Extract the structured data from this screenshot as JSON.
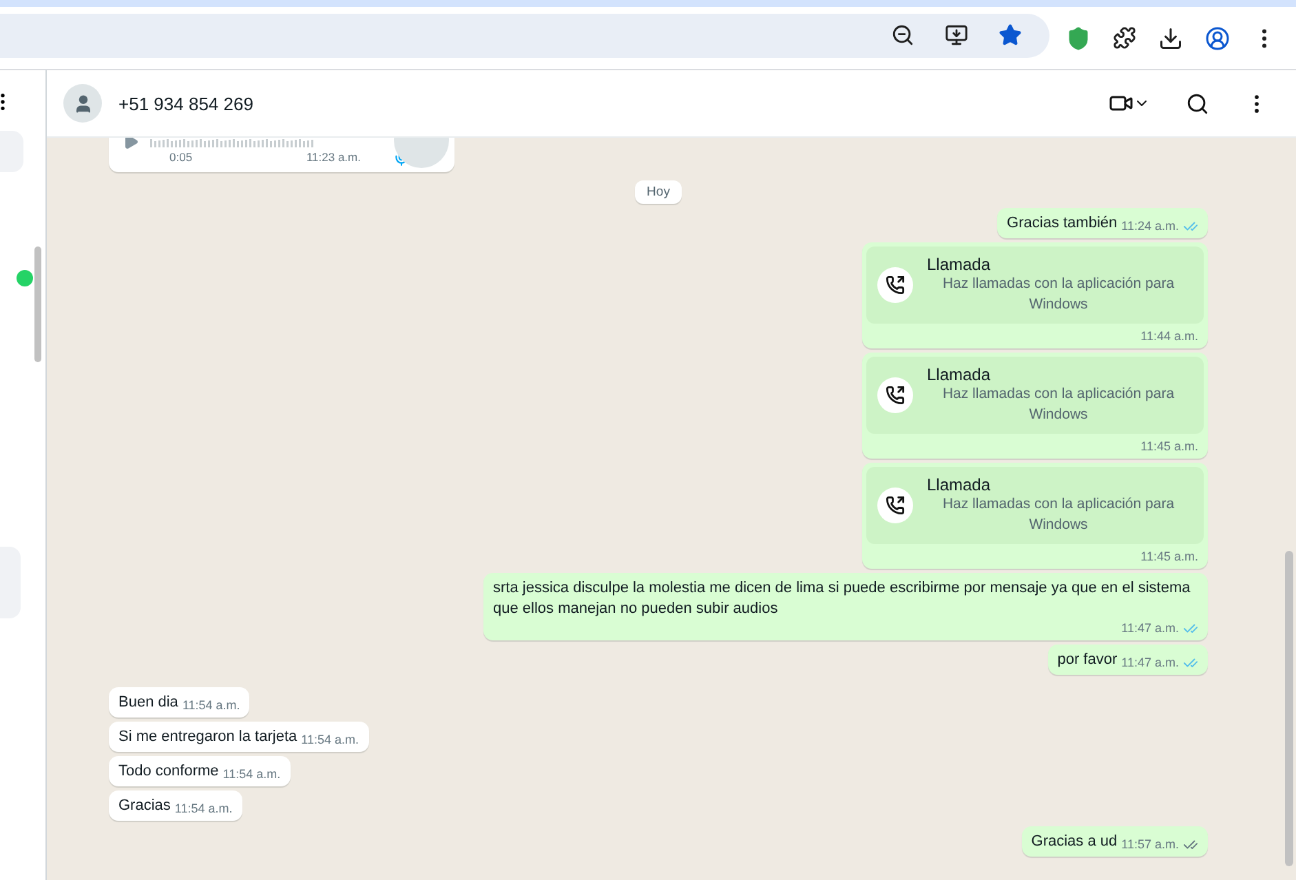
{
  "contact": {
    "name": "+51 934 854 269"
  },
  "messages": [
    {
      "kind": "audio",
      "outgoing": false,
      "duration": "0:05",
      "time": "11:23 a.m."
    },
    {
      "kind": "date",
      "label": "Hoy"
    },
    {
      "kind": "text",
      "outgoing": true,
      "text": "Gracias también",
      "time": "11:24 a.m.",
      "read": true
    },
    {
      "kind": "call",
      "outgoing": true,
      "title": "Llamada",
      "note": "Haz llamadas con la aplicación para Windows",
      "time": "11:44 a.m."
    },
    {
      "kind": "call",
      "outgoing": true,
      "title": "Llamada",
      "note": "Haz llamadas con la aplicación para Windows",
      "time": "11:45 a.m."
    },
    {
      "kind": "call",
      "outgoing": true,
      "title": "Llamada",
      "note": "Haz llamadas con la aplicación para Windows",
      "time": "11:45 a.m."
    },
    {
      "kind": "text",
      "outgoing": true,
      "text": "srta jessica disculpe la molestia me dicen de lima si puede escribirme por mensaje ya que en el sistema que ellos manejan no pueden subir audios",
      "time": "11:47 a.m.",
      "read": true
    },
    {
      "kind": "text",
      "outgoing": true,
      "text": "por favor",
      "time": "11:47 a.m.",
      "read": true
    },
    {
      "kind": "text",
      "outgoing": false,
      "text": "Buen dia",
      "time": "11:54 a.m."
    },
    {
      "kind": "text",
      "outgoing": false,
      "text": "Si me entregaron la tarjeta",
      "time": "11:54 a.m."
    },
    {
      "kind": "text",
      "outgoing": false,
      "text": "Todo conforme",
      "time": "11:54 a.m."
    },
    {
      "kind": "text",
      "outgoing": false,
      "text": "Gracias",
      "time": "11:54 a.m."
    },
    {
      "kind": "text",
      "outgoing": true,
      "text": "Gracias a ud",
      "time": "11:57 a.m.",
      "read": false
    }
  ]
}
